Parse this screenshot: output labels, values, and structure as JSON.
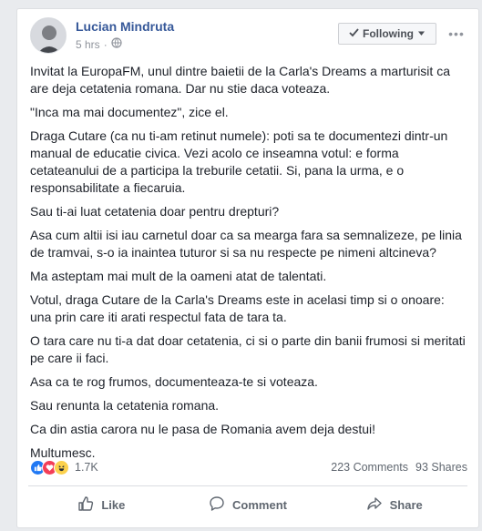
{
  "post": {
    "author": "Lucian Mindruta",
    "time": "5 hrs",
    "privacy_icon": "globe-icon",
    "follow_label": "Following",
    "paragraphs": [
      "Invitat la EuropaFM, unul dintre baietii de la Carla's Dreams a marturisit ca are deja cetatenia romana. Dar nu stie daca voteaza.",
      "\"Inca ma mai documentez\", zice el.",
      "Draga Cutare (ca nu ti-am retinut numele): poti sa te documentezi dintr-un manual de educatie civica. Vezi acolo ce inseamna votul: e forma cetateanului de a participa la treburile cetatii. Si, pana la urma, e o responsabilitate a fiecaruia.",
      "Sau ti-ai luat cetatenia doar pentru drepturi?",
      "Asa cum altii isi iau carnetul doar ca sa mearga fara sa semnalizeze, pe linia de tramvai, s-o ia inaintea tuturor si sa nu respecte pe nimeni altcineva?",
      "Ma asteptam mai mult de la oameni atat de talentati.",
      "Votul, draga Cutare de la Carla's Dreams este in acelasi timp si o onoare: una prin care iti arati respectul fata de tara ta.",
      "O tara care nu ti-a dat doar cetatenia, ci si o parte din banii frumosi si meritati pe care ii faci.",
      "Asa ca te rog frumos, documenteaza-te si voteaza.",
      "Sau renunta la cetatenia romana.",
      "Ca din astia carora nu le pasa de Romania avem deja destui!",
      "Multumesc."
    ]
  },
  "stats": {
    "reaction_count": "1.7K",
    "comments": "223 Comments",
    "shares": "93 Shares"
  },
  "actions": {
    "like": "Like",
    "comment": "Comment",
    "share": "Share"
  },
  "colors": {
    "link": "#365899",
    "like_reaction": "#2078f4",
    "love_reaction": "#f33e58",
    "haha_reaction": "#fcd14d"
  }
}
